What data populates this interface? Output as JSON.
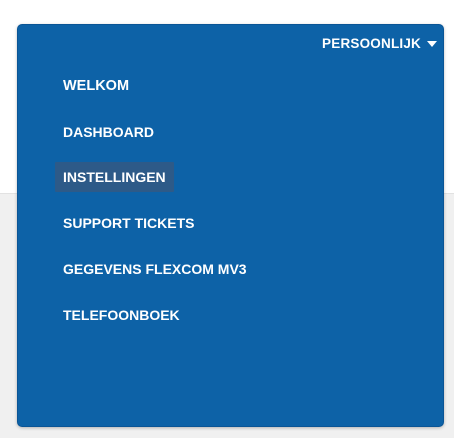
{
  "menu": {
    "header_label": "PERSOONLIJK",
    "header_icon": "caret-down-icon",
    "items": [
      {
        "label": "WELKOM",
        "type": "heading"
      },
      {
        "label": "DASHBOARD",
        "type": "link"
      },
      {
        "label": "INSTELLINGEN",
        "type": "link",
        "active": true
      },
      {
        "label": "SUPPORT TICKETS",
        "type": "link"
      },
      {
        "label": "GEGEVENS FLEXCOM MV3",
        "type": "link"
      },
      {
        "label": "TELEFOONBOEK",
        "type": "link"
      }
    ]
  },
  "colors": {
    "panel_background": "#0d62a7",
    "active_item_background": "#2d5a88",
    "text": "#ffffff"
  }
}
